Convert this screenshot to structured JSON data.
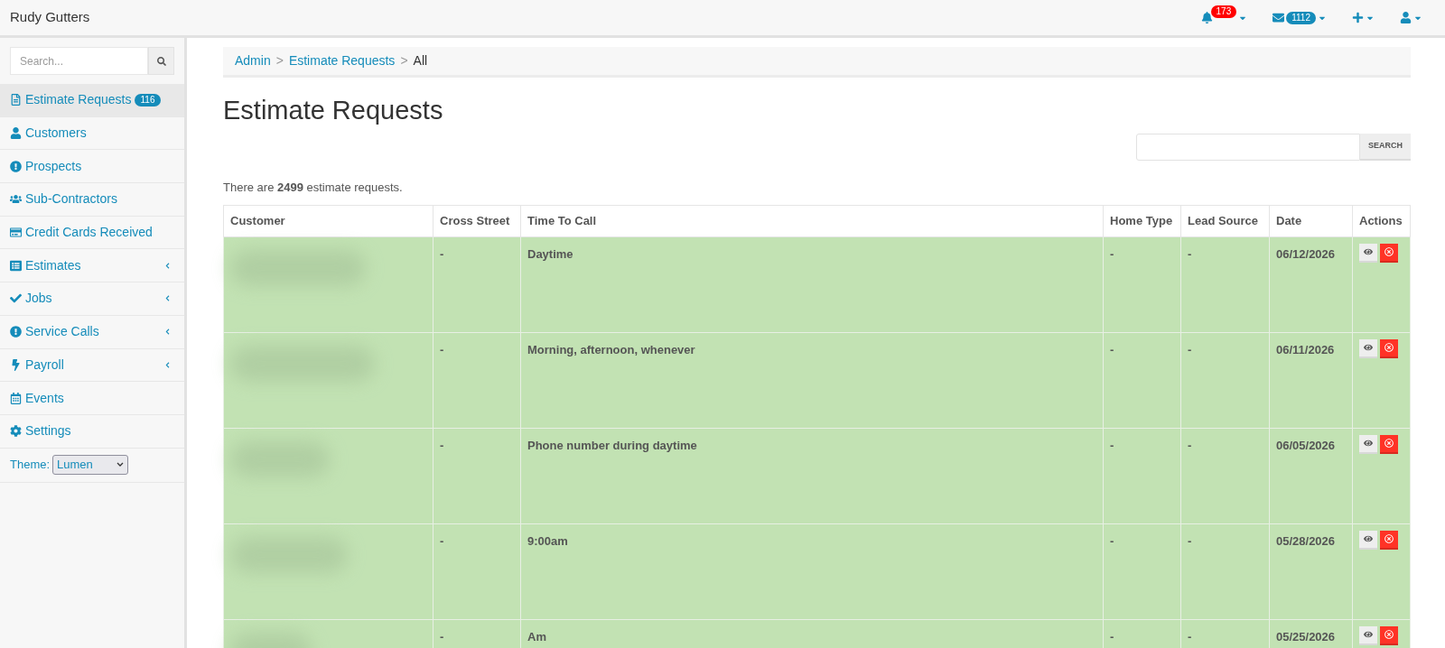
{
  "navbar": {
    "brand": "Rudy Gutters",
    "items": [
      {
        "kind": "bell",
        "badge": "173",
        "color": "#ff0000"
      },
      {
        "kind": "envelope",
        "badge": "1112",
        "color": "#158cba"
      },
      {
        "kind": "plus"
      },
      {
        "kind": "user"
      }
    ]
  },
  "sidebar": {
    "search": {
      "placeholder": "Search..."
    },
    "items": [
      {
        "kind": "file",
        "label": "Estimate Requests",
        "badge": "116",
        "selected": true,
        "has_submenu": false
      },
      {
        "kind": "user",
        "label": "Customers",
        "selected": false,
        "has_submenu": false
      },
      {
        "kind": "alert",
        "label": "Prospects",
        "selected": false,
        "has_submenu": false
      },
      {
        "kind": "users",
        "label": "Sub-Contractors",
        "selected": false,
        "has_submenu": false
      },
      {
        "kind": "card",
        "label": "Credit Cards Received",
        "selected": false,
        "has_submenu": false
      },
      {
        "kind": "list",
        "label": "Estimates",
        "selected": false,
        "has_submenu": true
      },
      {
        "kind": "check",
        "label": "Jobs",
        "selected": false,
        "has_submenu": true
      },
      {
        "kind": "alert",
        "label": "Service Calls",
        "selected": false,
        "has_submenu": true
      },
      {
        "kind": "bolt",
        "label": "Payroll",
        "selected": false,
        "has_submenu": true
      },
      {
        "kind": "calendar",
        "label": "Events",
        "selected": false,
        "has_submenu": false
      },
      {
        "kind": "gear",
        "label": "Settings",
        "selected": false,
        "has_submenu": false
      }
    ],
    "theme": {
      "label": "Theme:",
      "value": "Lumen"
    }
  },
  "breadcrumb": [
    {
      "label": "Admin",
      "link": true,
      "separator": ">"
    },
    {
      "label": "Estimate Requests",
      "link": true,
      "separator": ">"
    },
    {
      "label": "All",
      "link": false
    }
  ],
  "page_title": "Estimate Requests",
  "search_button": "SEARCH",
  "summary": "There are **2499** estimate requests.",
  "table": {
    "columns": [
      "Customer",
      "Cross Street",
      "Time To Call",
      "Home Type",
      "Lead Source",
      "Date",
      "Actions"
    ],
    "rows": [
      {
        "cross_street": "-",
        "time_to_call": "Daytime",
        "home_type": "-",
        "lead_source": "-",
        "date": "06/12/2026"
      },
      {
        "cross_street": "-",
        "time_to_call": "Morning, afternoon, whenever",
        "home_type": "-",
        "lead_source": "-",
        "date": "06/11/2026"
      },
      {
        "cross_street": "-",
        "time_to_call": "Phone number during daytime",
        "home_type": "-",
        "lead_source": "-",
        "date": "06/05/2026"
      },
      {
        "cross_street": "-",
        "time_to_call": "9:00am",
        "home_type": "-",
        "lead_source": "-",
        "date": "05/28/2026"
      },
      {
        "cross_street": "-",
        "time_to_call": "Am",
        "home_type": "-",
        "lead_source": "-",
        "date": "05/25/2026"
      }
    ]
  }
}
